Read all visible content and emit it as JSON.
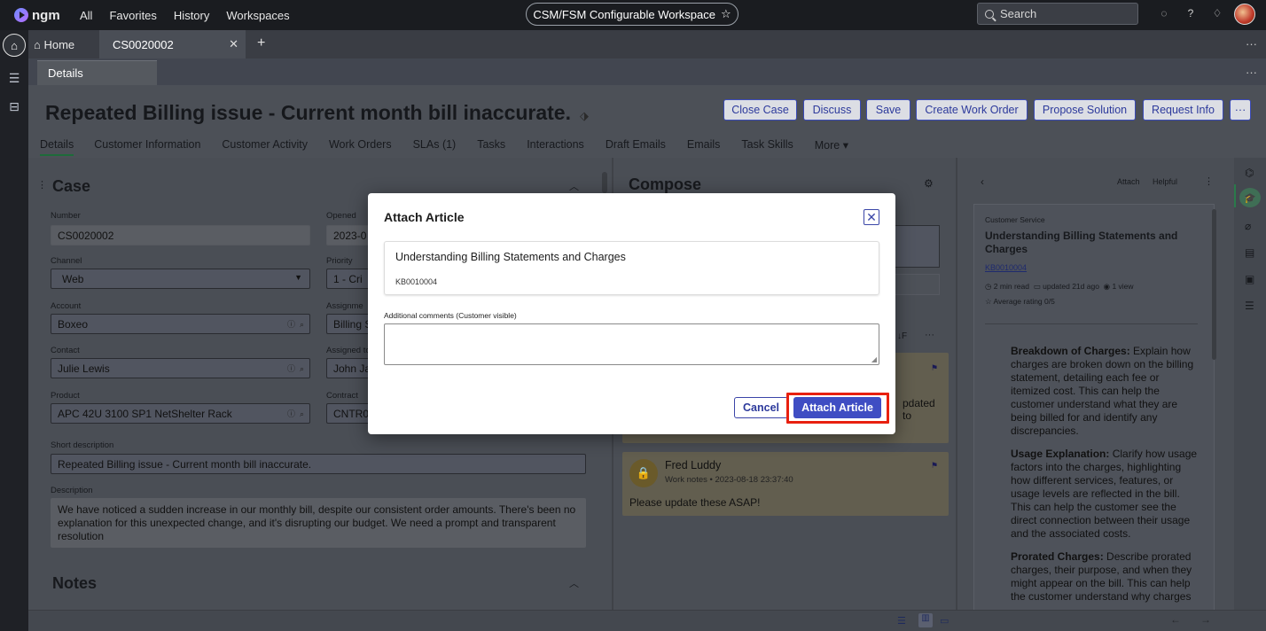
{
  "topbar": {
    "logo": "ngm",
    "nav": [
      "All",
      "Favorites",
      "History",
      "Workspaces"
    ],
    "workspace": "CSM/FSM Configurable Workspace",
    "search_placeholder": "Search"
  },
  "tabs": {
    "home": "Home",
    "case": "CS0020002"
  },
  "subtab": "Details",
  "record": {
    "title": "Repeated Billing issue - Current month bill inaccurate.",
    "buttons": [
      "Close Case",
      "Discuss",
      "Save",
      "Create Work Order",
      "Propose Solution",
      "Request Info"
    ],
    "tabs": [
      "Details",
      "Customer Information",
      "Customer Activity",
      "Work Orders",
      "SLAs (1)",
      "Tasks",
      "Interactions",
      "Draft Emails",
      "Emails",
      "Task Skills",
      "More"
    ]
  },
  "case": {
    "section_title": "Case",
    "number_label": "Number",
    "number": "CS0020002",
    "opened_label": "Opened",
    "opened": "2023-0",
    "channel_label": "Channel",
    "channel": "Web",
    "priority_label": "Priority",
    "priority": "1 - Cri",
    "account_label": "Account",
    "account": "Boxeo",
    "assignment_label": "Assignme",
    "assignment": "Billing S",
    "contact_label": "Contact",
    "contact": "Julie Lewis",
    "assigned_label": "Assigned to",
    "assigned": "John Ja",
    "product_label": "Product",
    "product": "APC 42U 3100 SP1 NetShelter Rack",
    "contract_label": "Contract",
    "contract": "CNTR0",
    "short_desc_label": "Short description",
    "short_desc": "Repeated Billing issue - Current month bill inaccurate.",
    "desc_label": "Description",
    "desc": "We have noticed a sudden increase in our monthly bill, despite our consistent order amounts. There's been no explanation for this unexpected change, and it's disrupting our budget.  We need a prompt and transparent resolution",
    "notes_title": "Notes"
  },
  "compose": {
    "title": "Compose",
    "note1_partial": "pdated",
    "note1_partial2": "to",
    "note2_author": "Fred Luddy",
    "note2_meta": "Work notes • 2023-08-18 23:37:40",
    "note2_body": "Please update these ASAP!"
  },
  "kb": {
    "attach": "Attach",
    "helpful": "Helpful",
    "category": "Customer Service",
    "title": "Understanding Billing Statements and Charges",
    "number": "KB0010004",
    "read": "2 min read",
    "updated": "updated 21d ago",
    "views": "1 view",
    "rating": "Average rating 0/5",
    "p1_head": "Breakdown of Charges:",
    "p1_body": " Explain how charges are broken down on the billing statement, detailing each fee or itemized cost. This can help the customer understand what they are being billed for and identify any discrepancies.",
    "p2_head": "Usage Explanation:",
    "p2_body": " Clarify how usage factors into the charges, highlighting how different services, features, or usage levels are reflected in the bill. This can help the customer see the direct connection between their usage and the associated costs.",
    "p3_head": "Prorated Charges:",
    "p3_body": " Describe prorated charges, their purpose, and when they might appear on the bill. This can help the customer understand why charges"
  },
  "modal": {
    "title": "Attach Article",
    "article_title": "Understanding Billing Statements and Charges",
    "article_number": "KB0010004",
    "comments_label": "Additional comments (Customer visible)",
    "cancel": "Cancel",
    "attach": "Attach Article"
  }
}
